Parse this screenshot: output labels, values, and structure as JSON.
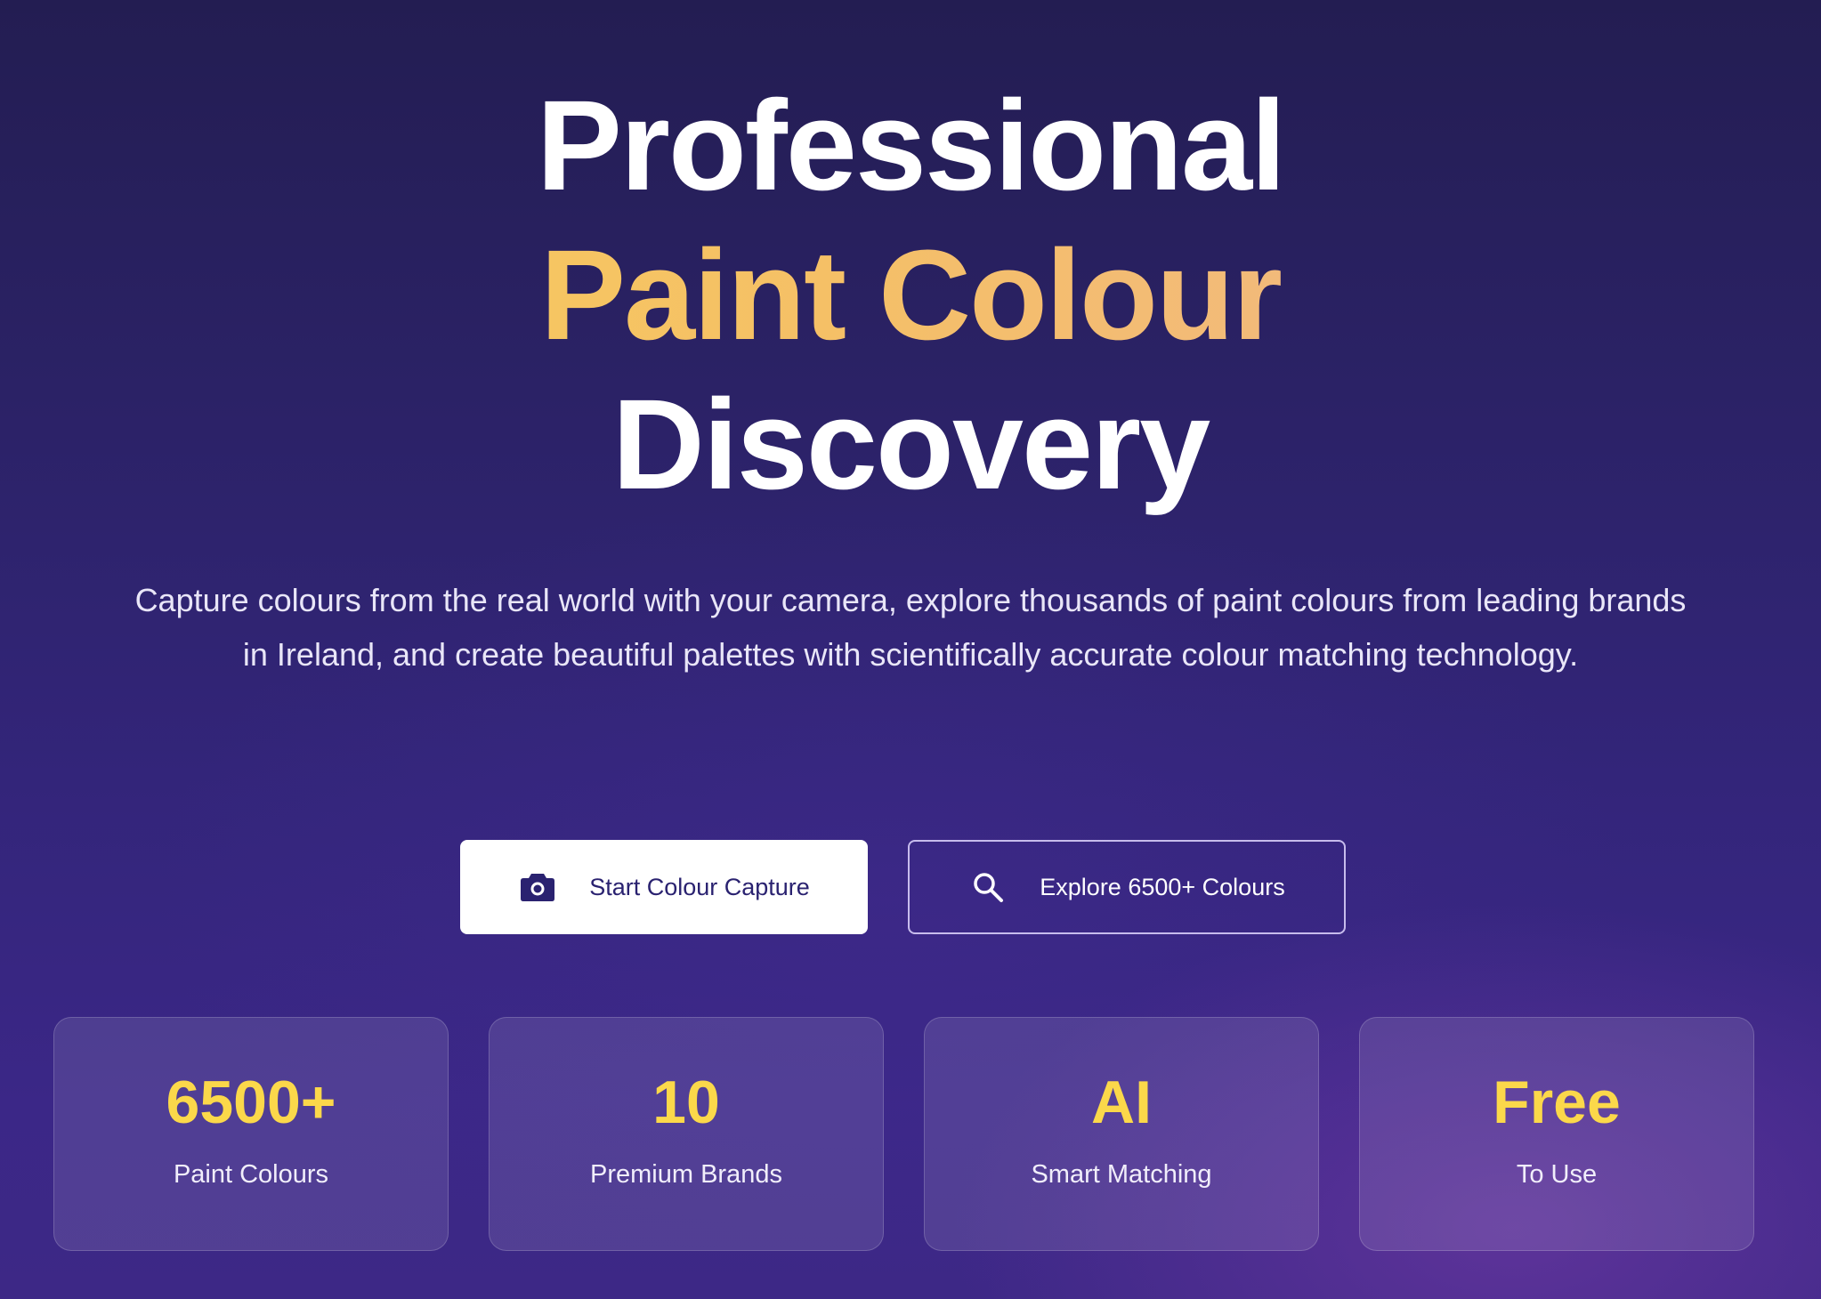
{
  "hero": {
    "title_line1": "Professional",
    "title_line2": "Paint Colour",
    "title_line3": "Discovery",
    "subtitle": "Capture colours from the real world with your camera, explore thousands of paint colours from leading brands in Ireland, and create beautiful palettes with scientifically accurate colour matching technology.",
    "accent_gradient": [
      "#f7cf5a",
      "#efb391"
    ]
  },
  "actions": {
    "primary": {
      "label": "Start Colour Capture",
      "icon": "camera-icon"
    },
    "secondary": {
      "label": "Explore 6500+ Colours",
      "icon": "search-icon"
    }
  },
  "stats": [
    {
      "value": "6500+",
      "label": "Paint Colours"
    },
    {
      "value": "10",
      "label": "Premium Brands"
    },
    {
      "value": "AI",
      "label": "Smart Matching"
    },
    {
      "value": "Free",
      "label": "To Use"
    }
  ],
  "colors": {
    "stat_value": "#fbd84a",
    "primary_button_text": "#2a2270",
    "background_top": "#231d52",
    "background_bottom": "#3d2886"
  }
}
